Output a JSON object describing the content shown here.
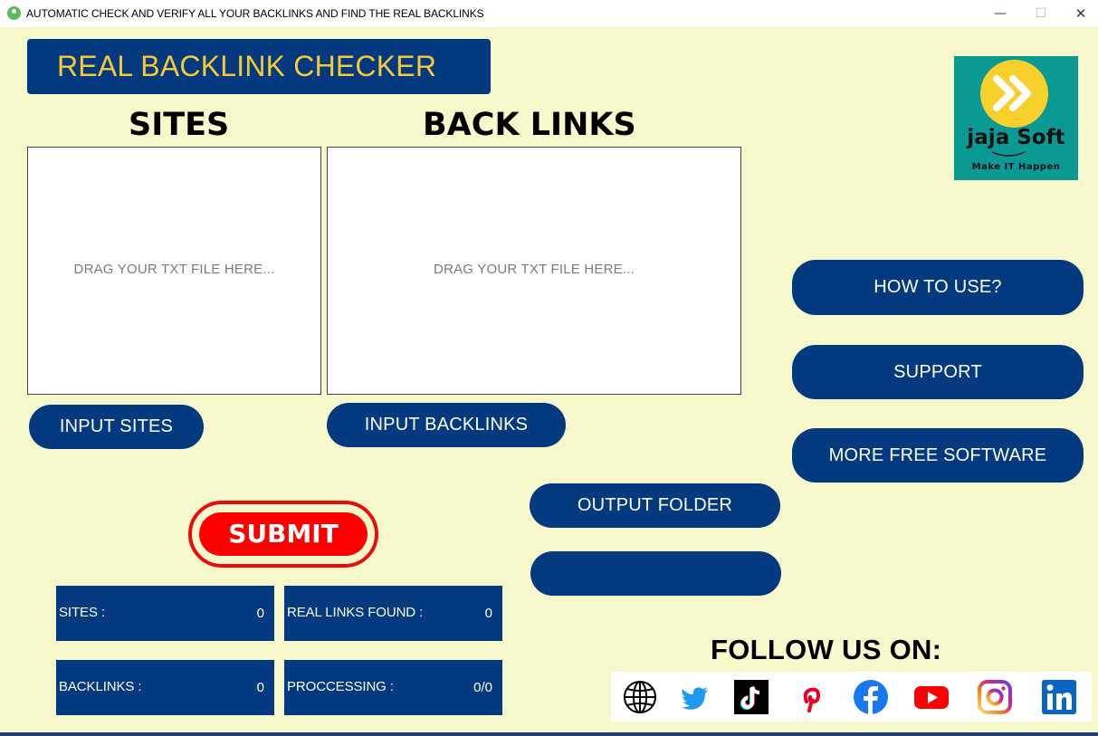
{
  "window": {
    "title": "AUTOMATIC CHECK AND VERIFY ALL YOUR BACKLINKS AND FIND THE REAL BACKLINKS",
    "minimize": "—",
    "maximize": "☐",
    "close": "✕"
  },
  "header": {
    "title": "REAL BACKLINK CHECKER"
  },
  "logo": {
    "name": "jaja Soft",
    "slogan": "Make IT Happen"
  },
  "sections": {
    "sites_title": "SITES",
    "backlinks_title": "BACK LINKS"
  },
  "sites_drop": {
    "placeholder": "DRAG YOUR TXT FILE HERE..."
  },
  "backlinks_drop": {
    "placeholder": "DRAG YOUR TXT FILE HERE..."
  },
  "buttons": {
    "input_sites": "INPUT SITES",
    "input_backlinks": "INPUT BACKLINKS",
    "how_to_use": "HOW TO USE?",
    "support": "SUPPORT",
    "more_free": "MORE FREE SOFTWARE",
    "output_folder": "OUTPUT FOLDER",
    "blank": "",
    "submit": "SUBMIT"
  },
  "stats": {
    "sites": {
      "label": "SITES :",
      "value": "0"
    },
    "real_links": {
      "label": "REAL LINKS FOUND :",
      "value": "0"
    },
    "backlinks": {
      "label": "BACKLINKS :",
      "value": "0"
    },
    "processing": {
      "label": "PROCCESSING :",
      "value": "0/0"
    }
  },
  "follow": {
    "title": "FOLLOW US ON:",
    "icons": [
      "globe-icon",
      "twitter-icon",
      "tiktok-icon",
      "pinterest-icon",
      "facebook-icon",
      "youtube-icon",
      "instagram-icon",
      "linkedin-icon"
    ]
  },
  "colors": {
    "background": "#f7f8cc",
    "navy": "#03397e",
    "header_text": "#f7c934",
    "submit_red": "#fe0000",
    "logo_teal": "#0b9994",
    "logo_yellow": "#f8d02b"
  }
}
